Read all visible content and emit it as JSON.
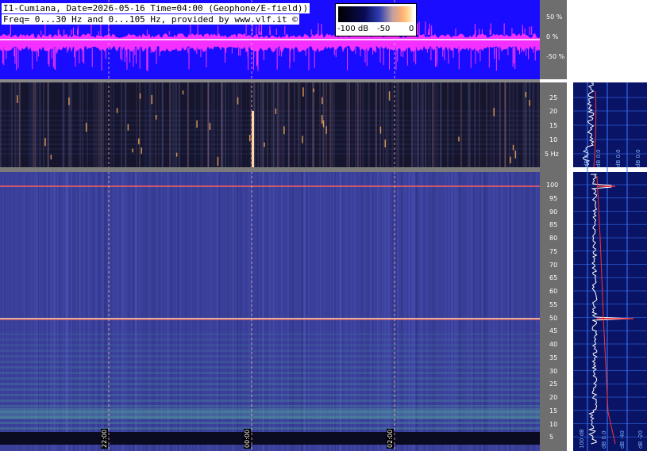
{
  "header": {
    "line1": "I1-Cumiana, Date=2026-05-16 Time=04:00 (Geophone/E-field))",
    "line2": "Freq= 0...30 Hz and 0...105 Hz, provided by www.vlf.it ©"
  },
  "color_scale": {
    "left_label": "-100 dB",
    "mid_label": "-50",
    "right_label": "0"
  },
  "amplitude_axis": {
    "ticks": [
      "50 %",
      "0 %",
      "-50 %"
    ]
  },
  "low_freq_axis": {
    "ticks": [
      "25",
      "20",
      "15",
      "10",
      "5 Hz"
    ]
  },
  "high_freq_axis": {
    "ticks": [
      "100",
      "95",
      "90",
      "85",
      "80",
      "75",
      "70",
      "65",
      "60",
      "55",
      "50",
      "45",
      "40",
      "35",
      "30",
      "25",
      "20",
      "15",
      "10",
      "5"
    ]
  },
  "time_axis": {
    "labels": [
      "22:00",
      "00:00",
      "02:00"
    ]
  },
  "side_panel_top": {
    "labels": [
      "dB 0.0",
      "dB 0.0",
      "dB 0.0",
      "dB 0.0"
    ]
  },
  "side_panel_bottom": {
    "labels": [
      "100 dB",
      "dB 0.0",
      "dB -40",
      "dB -20"
    ]
  },
  "colors": {
    "waveform_bg": "#1a0dff",
    "waveform_trace": "#ff33ff",
    "spectro_low_bg": "#15152e",
    "spectro_high_bg": "#3a3f9a",
    "line_50hz": "#ff6060",
    "side_bg": "#0a1466",
    "side_grid": "#3a78ff"
  }
}
